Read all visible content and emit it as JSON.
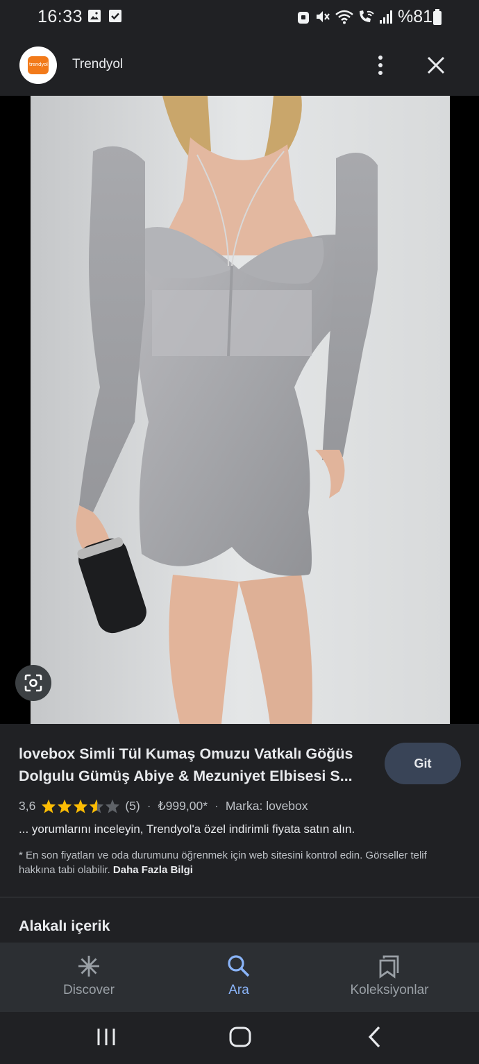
{
  "status_bar": {
    "time": "16:33",
    "battery_text": "%81",
    "icons": [
      "gallery-icon",
      "check-icon",
      "lock-icon",
      "mute-icon",
      "wifi-icon",
      "wifi-calling-icon",
      "signal-icon",
      "battery-icon"
    ]
  },
  "header": {
    "logo_text": "trendyol",
    "title": "Trendyol",
    "menu_icon": "more-vert-icon",
    "close_icon": "close-icon",
    "accent": "#f27a1a"
  },
  "image": {
    "lens_icon": "lens-icon"
  },
  "result": {
    "title_line1": "lovebox Simli Tül Kumaş Omuzu Vatkalı Göğüs",
    "title_line2": "Dolgulu Gümüş Abiye & Mezuniyet Elbisesi S...",
    "go_button": "Git",
    "rating": "3,6",
    "rating_value": 3.6,
    "stars_max": 5,
    "review_count": "(5)",
    "price": "₺999,00*",
    "brand": "Marka: lovebox",
    "snippet": "... yorumlarını inceleyin, Trendyol'a özel indirimli fiyata satın alın.",
    "disclaimer": "* En son fiyatları ve oda durumunu öğrenmek için web sitesini kontrol edin. Görseller telif hakkına tabi olabilir.",
    "more_info": "Daha Fazla Bilgi",
    "star_color": "#fbbc04"
  },
  "related": {
    "title": "Alakalı içerik"
  },
  "bottom_nav": {
    "items": [
      {
        "label": "Discover",
        "icon": "asterisk-icon",
        "active": false
      },
      {
        "label": "Ara",
        "icon": "search-icon",
        "active": true
      },
      {
        "label": "Koleksiyonlar",
        "icon": "collections-icon",
        "active": false
      }
    ],
    "active_color": "#8ab4f8"
  },
  "system_nav": {
    "icons": [
      "recent-apps-icon",
      "home-icon",
      "back-icon"
    ]
  }
}
